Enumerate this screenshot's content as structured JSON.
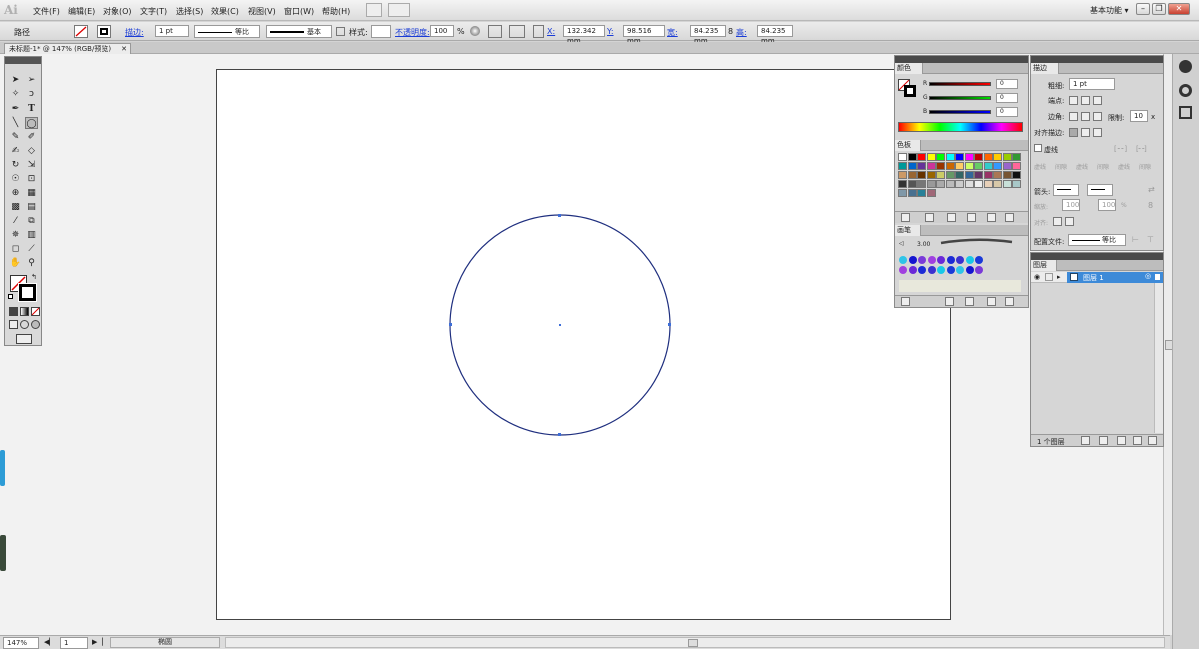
{
  "app": {
    "logo": "Ai",
    "workspace": "基本功能 ▾"
  },
  "menu": [
    {
      "label": "文件(F)"
    },
    {
      "label": "编辑(E)"
    },
    {
      "label": "对象(O)"
    },
    {
      "label": "文字(T)"
    },
    {
      "label": "选择(S)"
    },
    {
      "label": "效果(C)"
    },
    {
      "label": "视图(V)"
    },
    {
      "label": "窗口(W)"
    },
    {
      "label": "帮助(H)"
    }
  ],
  "control": {
    "selection": "路径",
    "stroke_label": "描边:",
    "stroke_weight": "1 pt",
    "profile_label": "等比",
    "brush_label": "基本",
    "style_label": "样式:",
    "opacity_label": "不透明度:",
    "opacity_value": "100",
    "percent": "%",
    "x_label": "X:",
    "x_value": "132.342 mm",
    "y_label": "Y:",
    "y_value": "98.516 mm",
    "w_label": "宽:",
    "w_value": "84.235 mm",
    "h_label": "高:",
    "h_value": "84.235 mm"
  },
  "document": {
    "tab_title": "未标题-1* @ 147% (RGB/预览)",
    "close": "✕"
  },
  "status": {
    "zoom": "147%",
    "artboard": "1",
    "tool_name": "椭圆"
  },
  "color_panel": {
    "tab": "颜色",
    "channels": [
      {
        "label": "R",
        "value": "0",
        "color": "#c00000"
      },
      {
        "label": "G",
        "value": "0",
        "color": "#00b000"
      },
      {
        "label": "B",
        "value": "0",
        "color": "#0000c0"
      }
    ]
  },
  "swatches_panel": {
    "tab": "色板",
    "colors": [
      "#ffffff",
      "#000000",
      "#ff0000",
      "#ffff00",
      "#00ff00",
      "#00ffff",
      "#0000ff",
      "#ff00ff",
      "#c00000",
      "#ff6600",
      "#ffcc00",
      "#99cc00",
      "#339933",
      "#009999",
      "#0066cc",
      "#663399",
      "#cc3399",
      "#993300",
      "#cc6600",
      "#ffcc66",
      "#ccff66",
      "#66cc66",
      "#33cccc",
      "#3399ff",
      "#9966cc",
      "#ff6699",
      "#cc9966",
      "#996633",
      "#663300",
      "#996600",
      "#cccc66",
      "#669966",
      "#336666",
      "#336699",
      "#663366",
      "#993366",
      "#aa7755",
      "#775533"
    ],
    "greys": [
      "#111111",
      "#333333",
      "#555555",
      "#777777",
      "#999999",
      "#aaaaaa",
      "#bbbbbb",
      "#cccccc",
      "#dddddd",
      "#eeeeee"
    ],
    "extra": [
      "#e8d0b8",
      "#d8c8a8",
      "#c8e0d8",
      "#a8c8c8",
      "#8098a8",
      "#487090",
      "#288098",
      "#a06878"
    ]
  },
  "brush_panel": {
    "tab": "画笔",
    "size": "3.00",
    "dots": [
      "#2fc4e8",
      "#1414d0",
      "#7a3ad8",
      "#a040e0",
      "#6a28d8",
      "#1c2ad6",
      "#3a30d0",
      "#18c8e8",
      "#1a3ad8"
    ]
  },
  "stroke_panel": {
    "tab": "描边",
    "weight_label": "粗细:",
    "weight_value": "1 pt",
    "cap_label": "端点:",
    "corner_label": "边角:",
    "limit_label": "限制:",
    "limit_value": "10",
    "limit_unit": "x",
    "align_label": "对齐描边:",
    "dashed_label": "虚线",
    "dash_labels": [
      "虚线",
      "间隙",
      "虚线",
      "间隙",
      "虚线",
      "间隙"
    ],
    "arrow_label": "箭头:",
    "scale_label": "缩放:",
    "scale_value1": "100",
    "scale_value2": "100",
    "scale_unit": "%",
    "align_arrow_label": "对齐:",
    "profile_label": "配置文件:",
    "profile_value": "等比"
  },
  "layers_panel": {
    "tab": "图层",
    "layer_name": "图层 1",
    "footer": "1 个图层"
  },
  "colors": {
    "selection_blue": "#3d6ed8",
    "path": "#1f2f7f",
    "layer_row": "#3d8ad8"
  }
}
